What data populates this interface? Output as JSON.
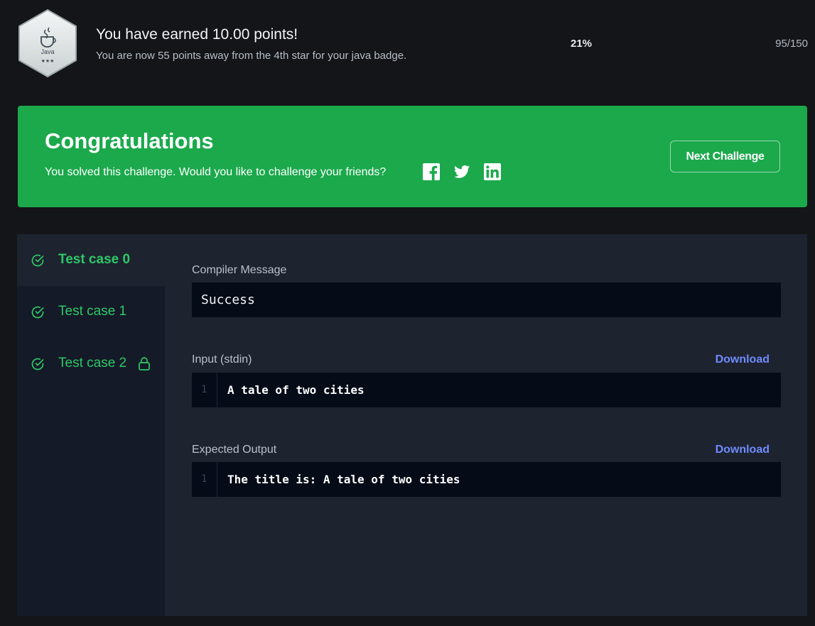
{
  "points": {
    "badge_language": "Java",
    "badge_stars": "★★★",
    "title": "You have earned 10.00 points!",
    "subtitle": "You are now 55 points away from the 4th star for your java badge.",
    "progress_percent": "21%",
    "progress_count": "95/150"
  },
  "banner": {
    "title": "Congratulations",
    "text": "You solved this challenge. Would you like to challenge your friends?",
    "share_icons": [
      "facebook-icon",
      "twitter-icon",
      "linkedin-icon"
    ],
    "next_button": "Next Challenge",
    "color": "#1ba94c"
  },
  "test_cases": [
    {
      "label": "Test case 0",
      "passed": true,
      "locked": false,
      "active": true
    },
    {
      "label": "Test case 1",
      "passed": true,
      "locked": false,
      "active": false
    },
    {
      "label": "Test case 2",
      "passed": true,
      "locked": true,
      "active": false
    }
  ],
  "result": {
    "compiler_label": "Compiler Message",
    "compiler_message": "Success",
    "input_label": "Input (stdin)",
    "input_download": "Download",
    "input_lines": [
      {
        "number": "1",
        "text": "A tale of two cities"
      }
    ],
    "expected_label": "Expected Output",
    "expected_download": "Download",
    "expected_lines": [
      {
        "number": "1",
        "text": "The title is: A tale of two cities"
      }
    ]
  },
  "colors": {
    "success_green": "#2ec866",
    "link_blue": "#6f8bfa",
    "panel_bg": "#1e2330",
    "code_bg": "#050b17"
  }
}
